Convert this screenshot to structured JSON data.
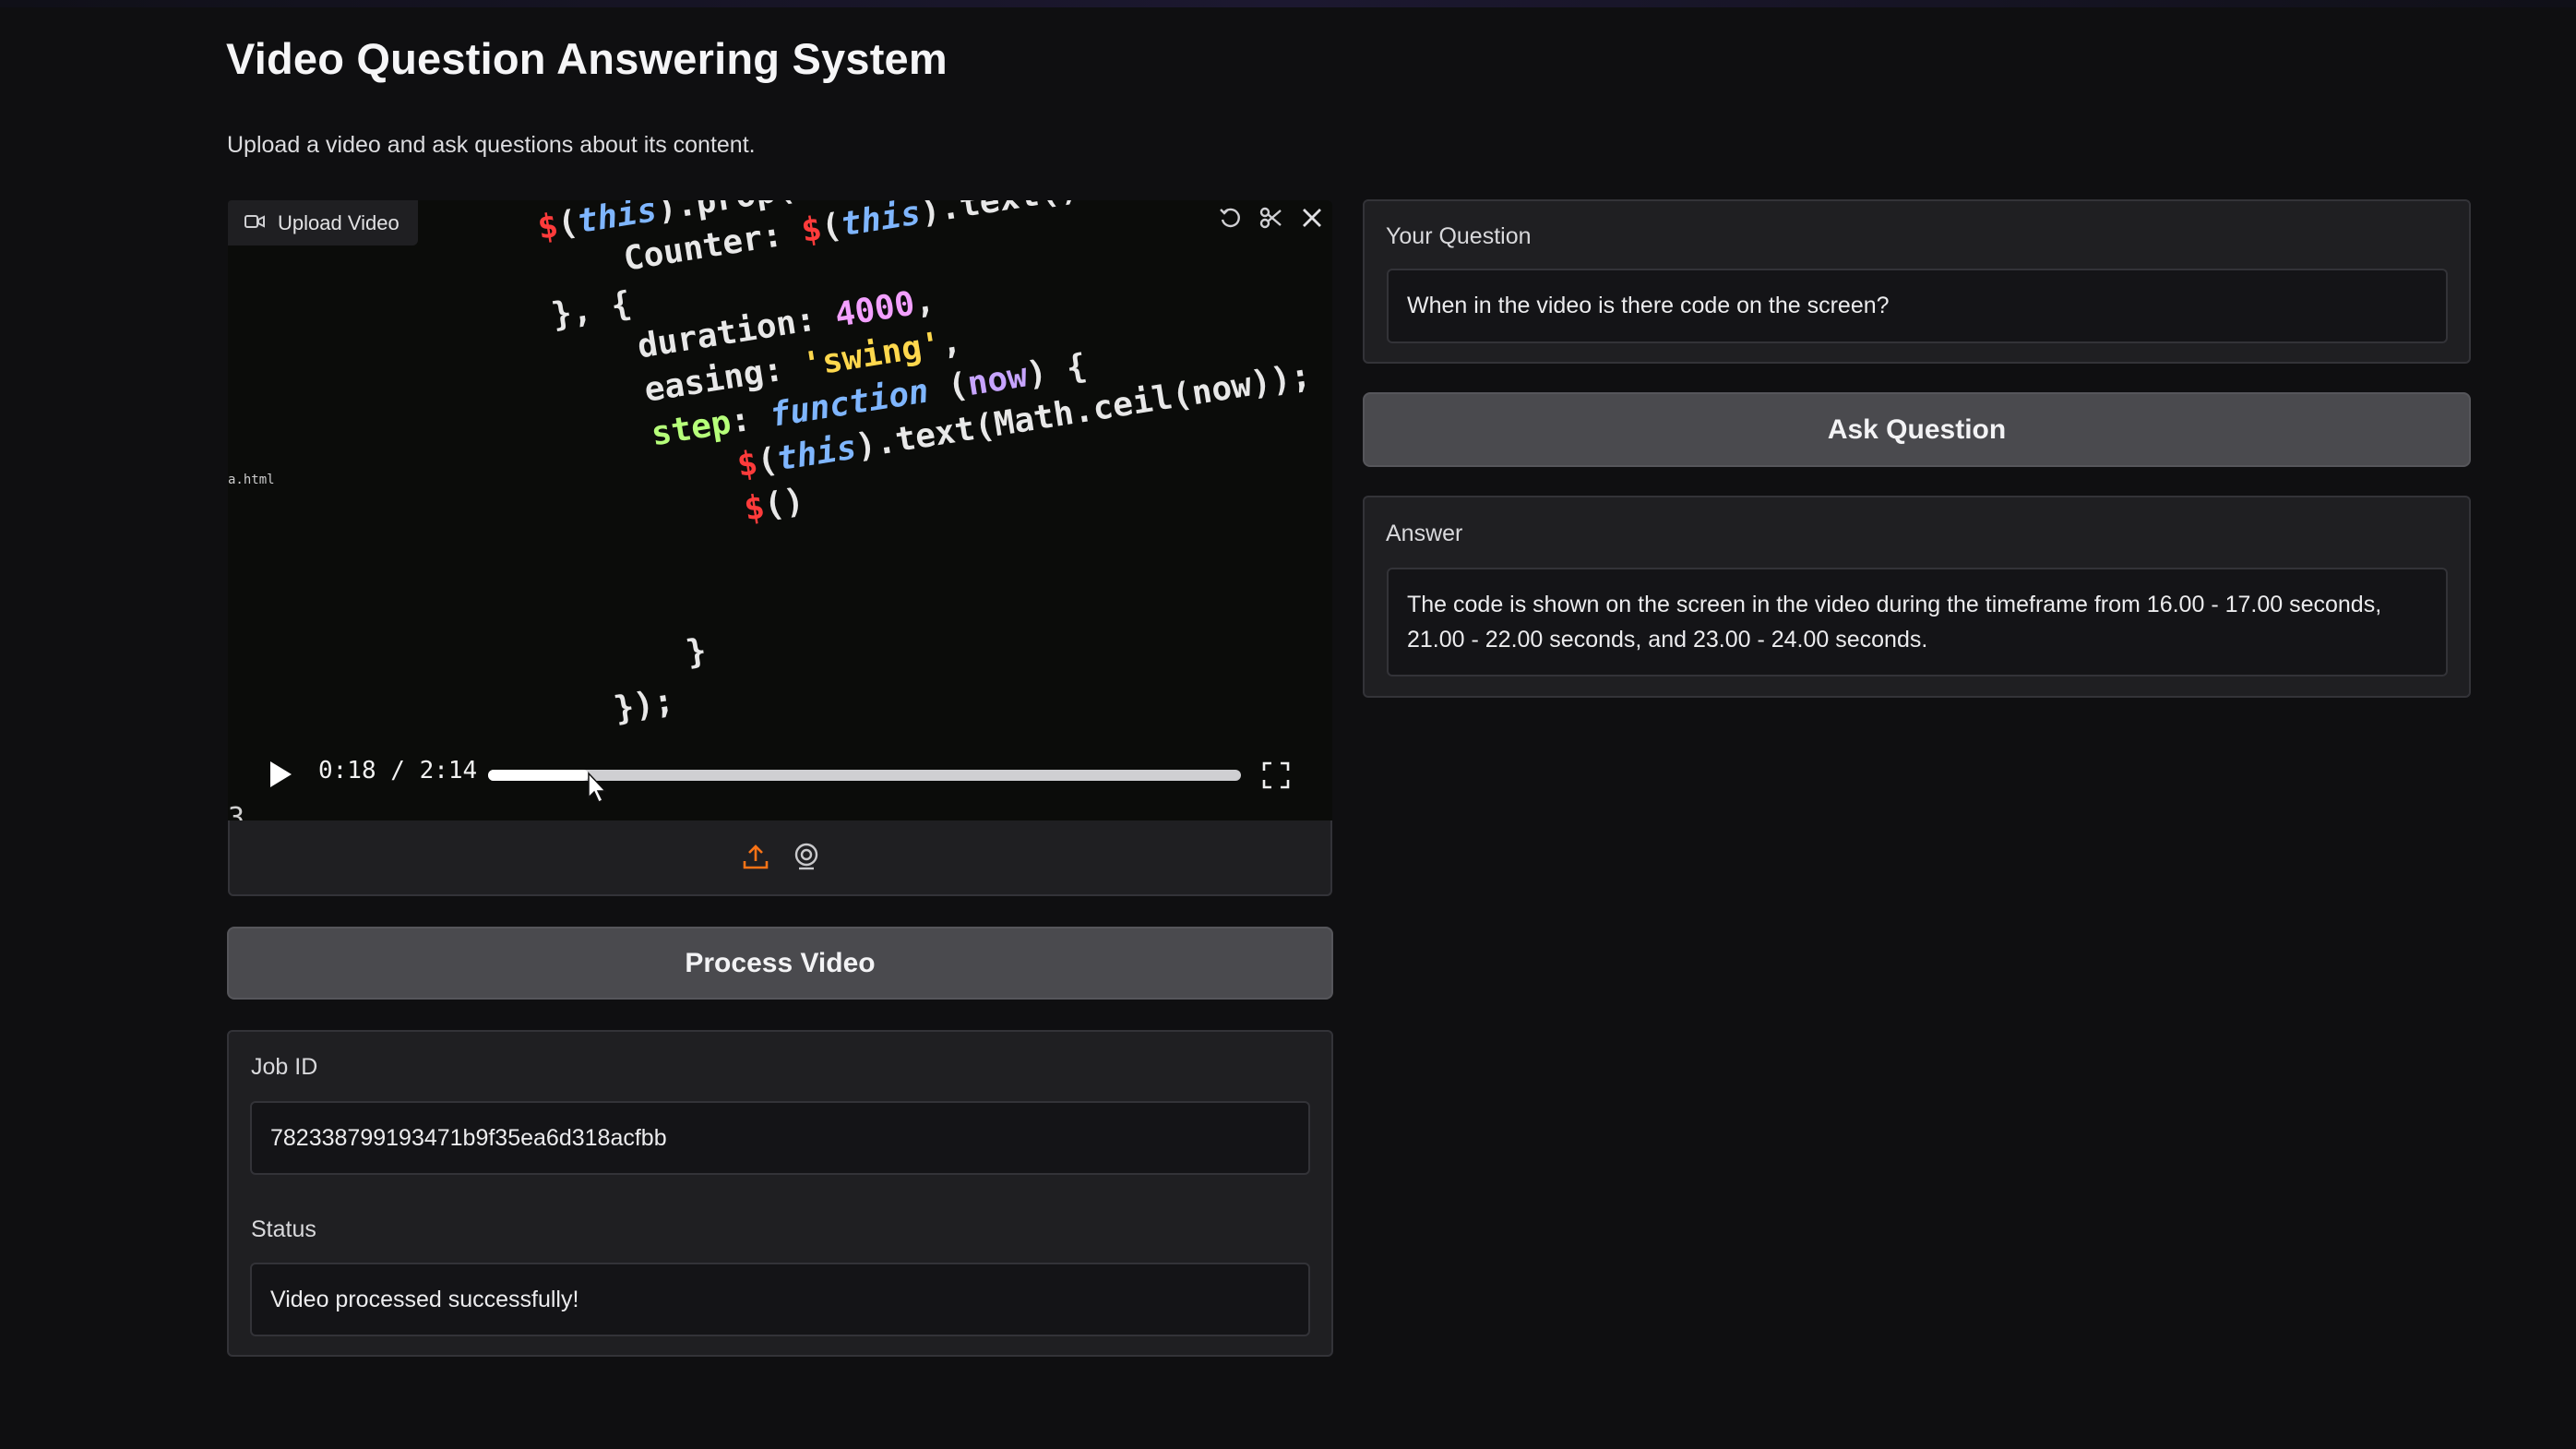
{
  "app": {
    "title": "Video Question Answering System",
    "subtitle": "Upload a video and ask questions about its content."
  },
  "video": {
    "badge_label": "Upload Video",
    "time_display": "0:18 / 2:14",
    "progress": 0.134,
    "tool_icons": [
      "undo-icon",
      "scissors-icon",
      "close-icon"
    ],
    "footer_icons": [
      "upload-icon",
      "webcam-icon"
    ],
    "accent_color": "#f97316"
  },
  "actions": {
    "process_label": "Process Video",
    "ask_label": "Ask Question"
  },
  "job": {
    "job_id_label": "Job ID",
    "job_id_value": "782338799193471b9f35ea6d318acfbb",
    "status_label": "Status",
    "status_value": "Video processed successfully!"
  },
  "question": {
    "label": "Your Question",
    "value": "When in the video is there code on the screen?"
  },
  "answer": {
    "label": "Answer",
    "value": "The code is shown on the screen in the video during the timeframe from 16.00 - 17.00 seconds, 21.00 - 22.00 seconds, and 23.00 - 24.00 seconds."
  }
}
